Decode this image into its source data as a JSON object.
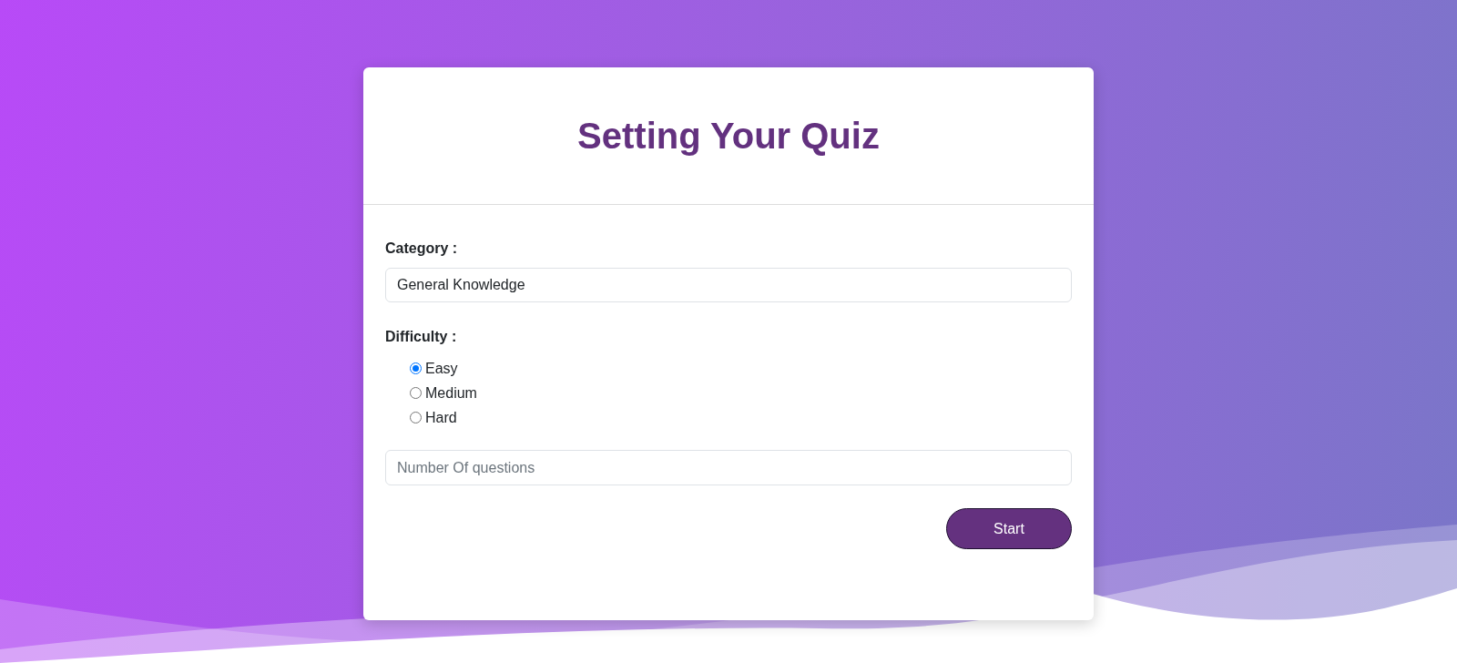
{
  "title": "Setting Your Quiz",
  "category": {
    "label": "Category :",
    "value": "General Knowledge"
  },
  "difficulty": {
    "label": "Difficulty :",
    "options": [
      {
        "label": "Easy",
        "selected": true
      },
      {
        "label": "Medium",
        "selected": false
      },
      {
        "label": "Hard",
        "selected": false
      }
    ]
  },
  "questions_field": {
    "placeholder": "Number Of questions"
  },
  "start_button": "Start"
}
